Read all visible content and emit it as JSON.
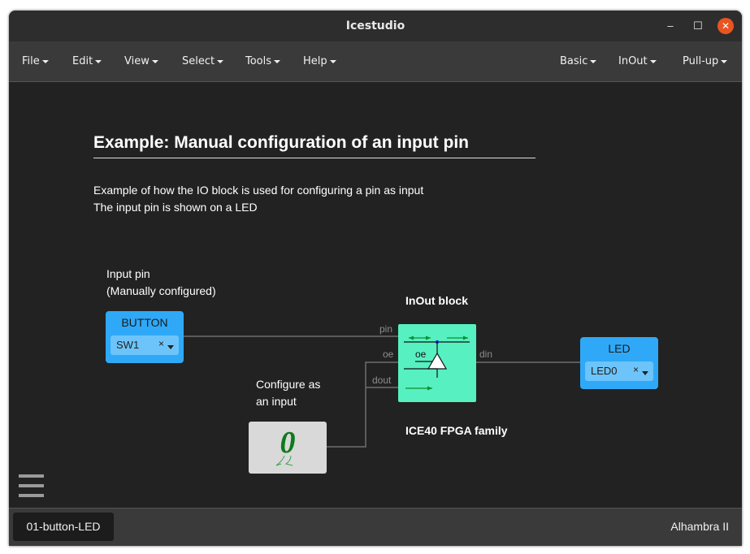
{
  "window": {
    "title": "Icestudio"
  },
  "menus_left": [
    "File",
    "Edit",
    "View",
    "Select",
    "Tools",
    "Help"
  ],
  "menus_right": [
    "Basic",
    "InOut",
    "Pull-up"
  ],
  "window_controls": {
    "minimize": "–",
    "maximize": "☐",
    "close": "✕"
  },
  "info": {
    "title": "Example: Manual configuration of an input pin",
    "line1": "Example of how the IO block is used for configuring a pin as input",
    "line2": "The input pin is shown on a LED"
  },
  "labels": {
    "input_pin_1": "Input pin",
    "input_pin_2": "(Manually configured)",
    "configure_1": "Configure as",
    "configure_2": "an input",
    "inout_block": "InOut block",
    "family": "ICE40 FPGA family"
  },
  "button_block": {
    "name": "BUTTON",
    "value": "SW1",
    "clear": "×"
  },
  "led_block": {
    "name": "LED",
    "value": "LED0",
    "clear": "×"
  },
  "inout": {
    "port_pin": "pin",
    "port_oe": "oe",
    "port_dout": "dout",
    "port_din": "din",
    "inner_oe": "oe"
  },
  "constant": {
    "value": "0"
  },
  "colors": {
    "io_block": "#2fa9f7",
    "inout_block": "#57f0c0",
    "arrow_green": "#0b8f2c",
    "close_button": "#e95420"
  },
  "status": {
    "file": "01-button-LED",
    "board": "Alhambra II"
  }
}
